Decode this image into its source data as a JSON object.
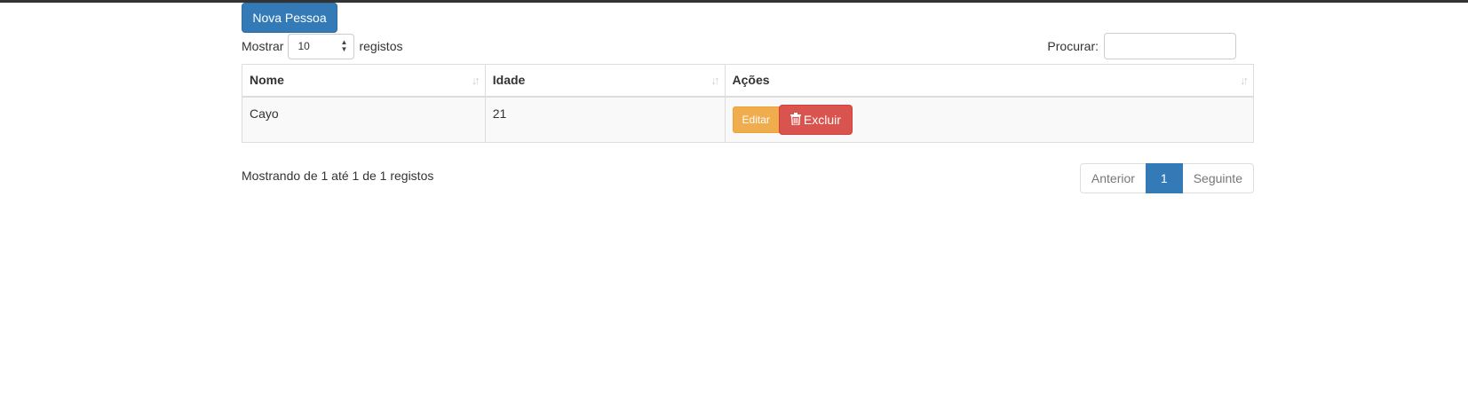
{
  "toolbar": {
    "new_button": "Nova Pessoa"
  },
  "length": {
    "before": "Mostrar",
    "value": "10",
    "after": "registos"
  },
  "filter": {
    "label": "Procurar:",
    "value": ""
  },
  "table": {
    "columns": [
      "Nome",
      "Idade",
      "Ações"
    ],
    "rows": [
      {
        "nome": "Cayo",
        "idade": "21",
        "edit_label": "Editar",
        "delete_label": "Excluir"
      }
    ]
  },
  "info": "Mostrando de 1 até 1 de 1 registos",
  "pagination": {
    "previous": "Anterior",
    "current": "1",
    "next": "Seguinte"
  },
  "icons": {
    "sort": "sort-icon",
    "delete": "trash-icon",
    "select": "select-arrows-icon"
  },
  "colors": {
    "primary": "#337ab7",
    "warning": "#f0ad4e",
    "danger": "#d9534f",
    "topbar": "#333333"
  }
}
